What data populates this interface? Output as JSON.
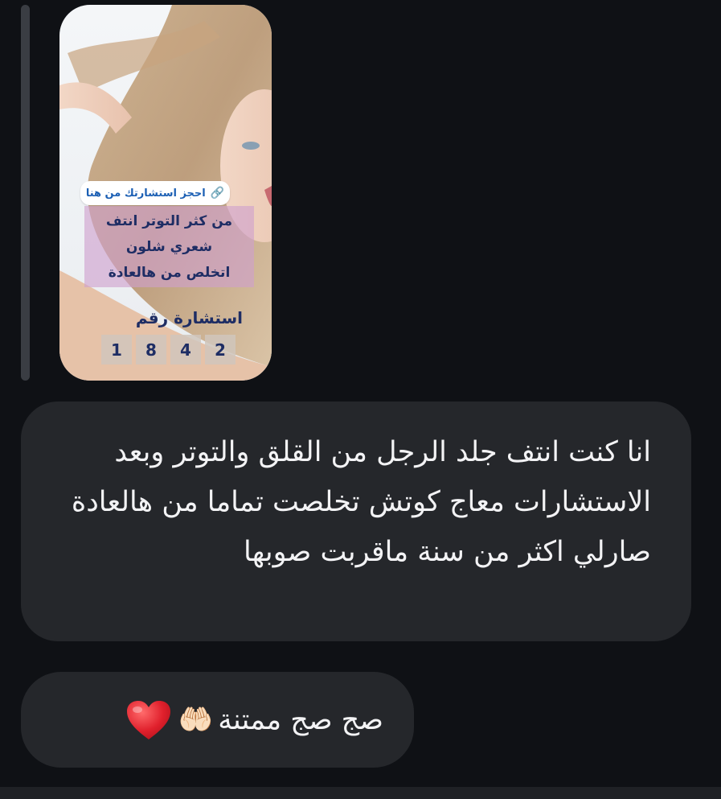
{
  "story": {
    "link_sticker": "احجز استشارتك من هنا",
    "headline": [
      "من كثر التوتر انتف",
      "شعري شلون",
      "اتخلص من هالعادة"
    ],
    "consult_label": "استشارة رقم",
    "consult_digits": [
      "1",
      "8",
      "4",
      "2"
    ]
  },
  "messages": [
    {
      "text": "انا كنت انتف جلد الرجل من القلق والتوتر وبعد الاستشارات معاج كوتش تخلصت تماما من هالعادة صارلي اكثر من سنة ماقربت صوبها"
    },
    {
      "text": "صج صج ممتنة",
      "emoji": "🤲🏻"
    }
  ],
  "colors": {
    "background": "#0f1115",
    "bubble": "#25272b",
    "text": "#f3f3f5",
    "story_text": "#1e2d64",
    "heart": "#e0202c"
  }
}
